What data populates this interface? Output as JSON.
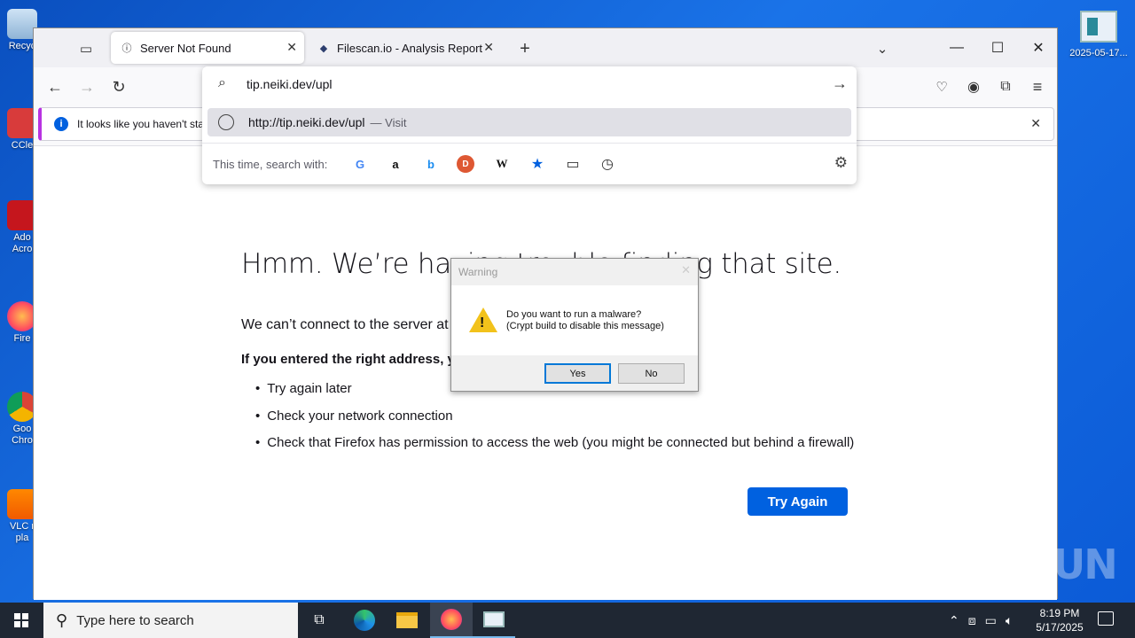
{
  "desktop": {
    "icons": [
      {
        "label": "Recyc",
        "icon": "recycle-bin-icon"
      },
      {
        "label": "CCle",
        "icon": "ccleaner-icon"
      },
      {
        "label": "Ado Acro",
        "icon": "acrobat-icon"
      },
      {
        "label": "Fire",
        "icon": "firefox-icon"
      },
      {
        "label": "Goo Chro",
        "icon": "chrome-icon"
      },
      {
        "label": "VLC r pla",
        "icon": "vlc-icon"
      }
    ],
    "right_icon_label": "2025-05-17..."
  },
  "browser": {
    "tabs": [
      {
        "title": "Server Not Found",
        "favicon": "info-icon"
      },
      {
        "title": "Filescan.io - Analysis Report for",
        "favicon": "filescan-icon"
      }
    ],
    "new_tab": "+",
    "url_input": "tip.neiki.dev/upl",
    "url_result": {
      "url": "http://tip.neiki.dev/upl",
      "action": "— Visit"
    },
    "search_with_label": "This time, search with:",
    "engines": [
      "G",
      "a",
      "b",
      "D",
      "W",
      "★",
      "▭",
      "◷"
    ],
    "notification_text": "It looks like you haven't star",
    "error": {
      "title": "Hmm. We’re having trouble finding that site.",
      "line1": "We can’t connect to the server at tip.neiki.dev.",
      "line2": "If you entered the right address, you can:",
      "tips": [
        "Try again later",
        "Check your network connection",
        "Check that Firefox has permission to access the web (you might be connected but behind a firewall)"
      ],
      "try_again": "Try Again"
    }
  },
  "dialog": {
    "title": "Warning",
    "message_line1": "Do you want to run a malware?",
    "message_line2": "(Crypt build to disable this message)",
    "yes": "Yes",
    "no": "No"
  },
  "watermark": "ANY RUN",
  "taskbar": {
    "search_placeholder": "Type here to search",
    "time": "8:19 PM",
    "date": "5/17/2025"
  },
  "colors": {
    "accent": "#0061e0",
    "desktop": "#1a73e8",
    "taskbar": "#1f2733"
  }
}
